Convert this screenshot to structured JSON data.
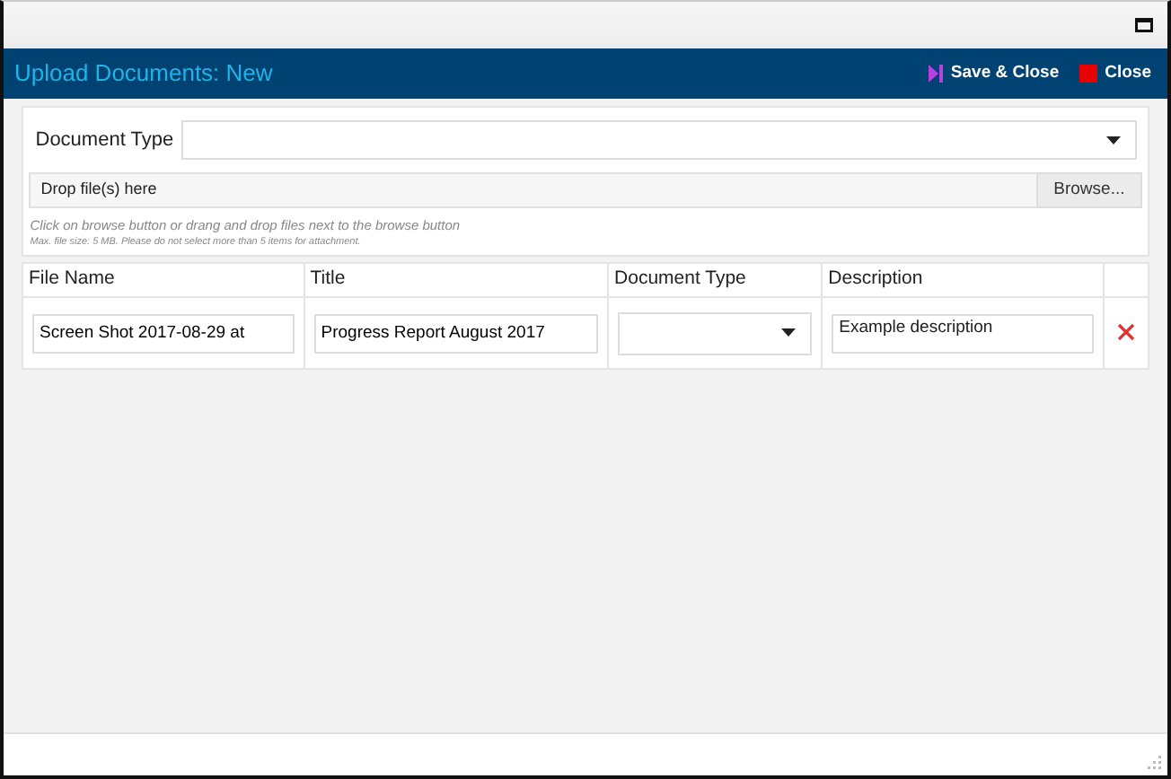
{
  "window": {
    "title": "Upload Documents: New"
  },
  "toolbar": [
    {
      "kind": "save",
      "label": "Save & Close"
    },
    {
      "kind": "close",
      "label": "Close"
    }
  ],
  "document_type": {
    "label": "Document Type"
  },
  "drop_zone": {
    "placeholder": "Drop file(s) here",
    "button": "Browse..."
  },
  "hints": [
    "Click on browse button or drang and drop files next to the browse button",
    "Max. file size: 5 MB. Please do not select more than 5 items for attachment."
  ],
  "table": {
    "columns": [
      "File Name",
      "Title",
      "Document Type",
      "Description"
    ],
    "rows": [
      {
        "file_name": "Screen Shot 2017-08-29 at",
        "title": "Progress Report August 2017",
        "description": "Example description"
      }
    ]
  }
}
